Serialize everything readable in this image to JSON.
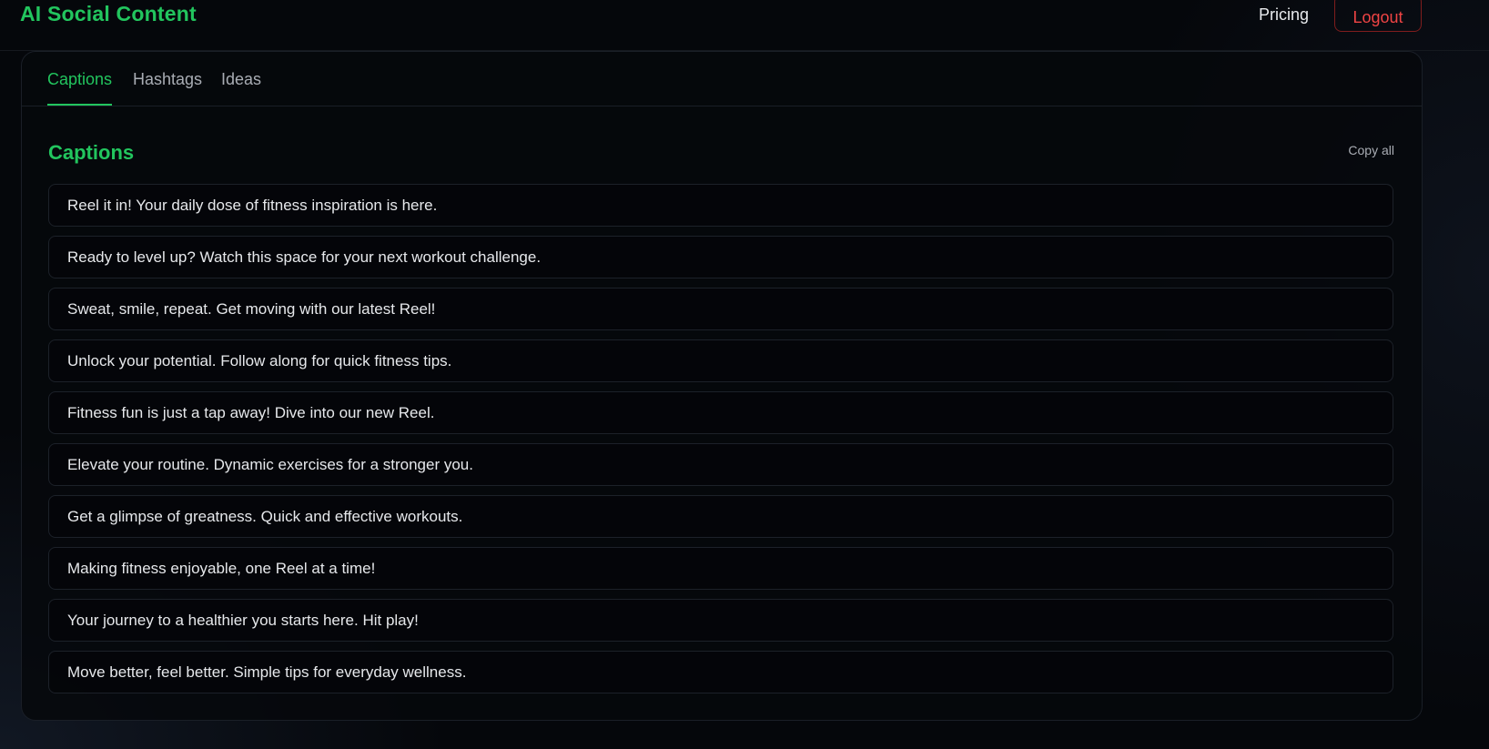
{
  "header": {
    "brand": "AI Social Content",
    "pricing_label": "Pricing",
    "logout_label": "Logout"
  },
  "tabs": [
    {
      "label": "Captions",
      "active": true
    },
    {
      "label": "Hashtags",
      "active": false
    },
    {
      "label": "Ideas",
      "active": false
    }
  ],
  "section": {
    "title": "Captions",
    "copy_all_label": "Copy all"
  },
  "captions": [
    "Reel it in! Your daily dose of fitness inspiration is here.",
    "Ready to level up? Watch this space for your next workout challenge.",
    "Sweat, smile, repeat. Get moving with our latest Reel!",
    "Unlock your potential. Follow along for quick fitness tips.",
    "Fitness fun is just a tap away! Dive into our new Reel.",
    "Elevate your routine. Dynamic exercises for a stronger you.",
    "Get a glimpse of greatness. Quick and effective workouts.",
    "Making fitness enjoyable, one Reel at a time!",
    "Your journey to a healthier you starts here. Hit play!",
    "Move better, feel better. Simple tips for everyday wellness."
  ],
  "colors": {
    "accent": "#22c55e",
    "danger": "#ef4444",
    "background": "#05070b"
  }
}
